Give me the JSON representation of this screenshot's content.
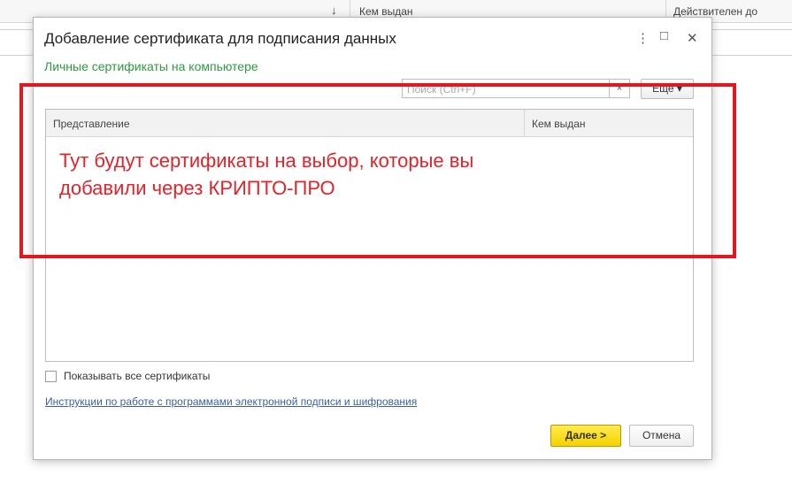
{
  "background": {
    "sort_icon": "↓",
    "columns": [
      "Кем выдан",
      "Действителен до"
    ]
  },
  "dialog": {
    "title": "Добавление сертификата для подписания данных",
    "controls": {
      "menu": "⋮",
      "maximize": "□",
      "close": "✕"
    },
    "subtitle": "Личные сертификаты на компьютере",
    "search": {
      "placeholder": "Поиск (Ctrl+F)",
      "value": "",
      "clear": "×"
    },
    "more_button": "Еще ▾",
    "table": {
      "columns": [
        "Представление",
        "Кем выдан"
      ],
      "rows": []
    },
    "annotation": "Тут будут сертификаты на выбор, которые вы добавили через КРИПТО-ПРО",
    "show_all_label": "Показывать все сертификаты",
    "show_all_checked": false,
    "instructions_link": "Инструкции по работе с программами электронной подписи и шифрования",
    "next_button": "Далее >",
    "cancel_button": "Отмена"
  },
  "colors": {
    "accent_green": "#2e9a42",
    "annotation_red": "#e3232a",
    "link_blue": "#3c5fa3",
    "primary_button_yellow": "#f5d200"
  }
}
